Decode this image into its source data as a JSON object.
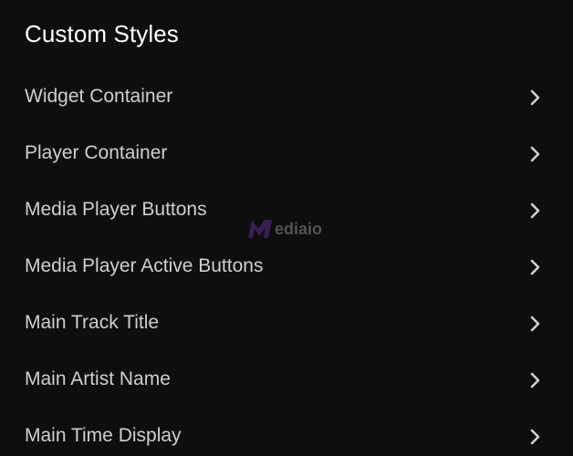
{
  "panel": {
    "title": "Custom Styles"
  },
  "items": [
    {
      "label": "Widget Container",
      "icon": "chevron-right-icon"
    },
    {
      "label": "Player Container",
      "icon": "chevron-right-icon"
    },
    {
      "label": "Media Player Buttons",
      "icon": "chevron-right-icon"
    },
    {
      "label": "Media Player Active Buttons",
      "icon": "chevron-right-icon"
    },
    {
      "label": "Main Track Title",
      "icon": "chevron-right-icon"
    },
    {
      "label": "Main Artist Name",
      "icon": "chevron-right-icon"
    },
    {
      "label": "Main Time Display",
      "icon": "chevron-right-icon"
    }
  ],
  "watermark": {
    "text": "ediaio",
    "logo_letter": "M",
    "logo_color": "#5a2d8c"
  },
  "colors": {
    "background": "#0e0e0f",
    "title": "#ffffff",
    "label": "#cfcfcf",
    "chevron": "#d0d0d0"
  }
}
